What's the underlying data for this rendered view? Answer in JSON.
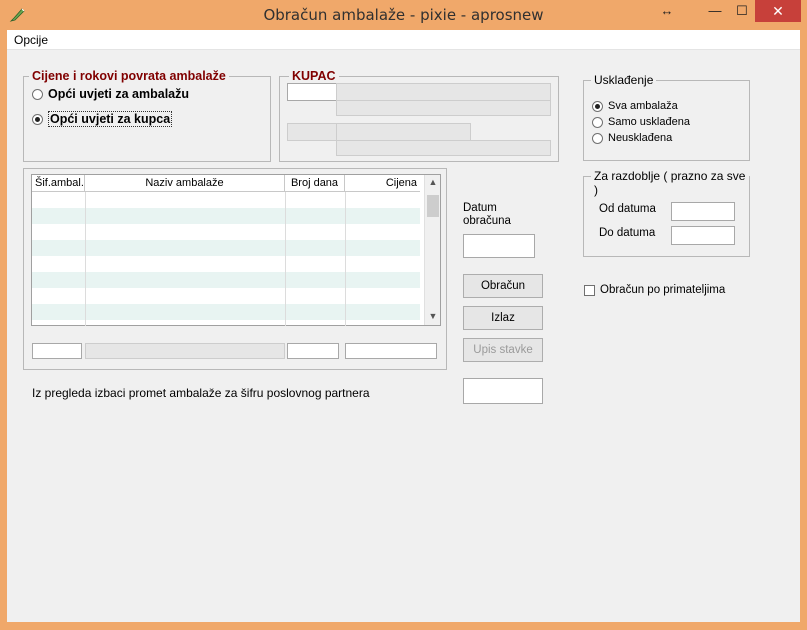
{
  "window": {
    "title": "Obračun ambalaže - pixie - aprosnew",
    "resize_glyph": "↔",
    "minimize_glyph": "—",
    "maximize_glyph": "☐",
    "close_glyph": "✕"
  },
  "menu": {
    "items": [
      {
        "label": "Opcije"
      }
    ]
  },
  "cijene_group": {
    "title": "Cijene i rokovi povrata ambalaže",
    "options": [
      {
        "label": "Opći uvjeti za ambalažu",
        "checked": false
      },
      {
        "label": "Opći uvjeti za kupca",
        "checked": true
      }
    ]
  },
  "kupac_group": {
    "title": "KUPAC"
  },
  "uskladjenje_group": {
    "title": "Usklađenje",
    "options": [
      {
        "label": "Sva ambalaža",
        "checked": true
      },
      {
        "label": "Samo usklađena",
        "checked": false
      },
      {
        "label": "Neusklađena",
        "checked": false
      }
    ]
  },
  "razdoblje_group": {
    "title": "Za razdoblje ( prazno za sve )",
    "od_label": "Od datuma",
    "do_label": "Do datuma"
  },
  "grid": {
    "columns": [
      "Šif.ambal.",
      "Naziv ambalaže",
      "Broj dana",
      "Cijena"
    ],
    "rows": []
  },
  "datum": {
    "label": "Datum obračuna"
  },
  "buttons": {
    "obracun": "Obračun",
    "izlaz": "Izlaz",
    "upis": "Upis stavke"
  },
  "checkbox_primatelji": {
    "label": "Obračun po primateljima",
    "checked": false
  },
  "footer": {
    "label": "Iz pregleda izbaci promet ambalaže za šifru poslovnog partnera"
  },
  "colors": {
    "title_bar": "#f0a86a",
    "close_button": "#c7403a",
    "group_title_red": "#800000",
    "grid_alt_row": "#e8f4f2"
  }
}
